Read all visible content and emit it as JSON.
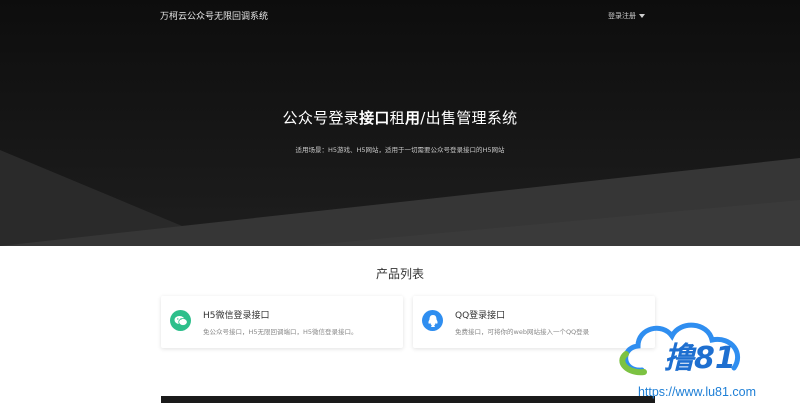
{
  "header": {
    "brand": "万柯云公众号无限回调系统",
    "login_register": "登录注册"
  },
  "hero": {
    "title_part1": "公众号登录",
    "title_bold1": "接口",
    "title_part2": "租",
    "title_bold2": "用",
    "title_part3": "/出售管理系统",
    "subtitle": "适用场景：H5游戏、H5网站，适用于一切需要公众号登录接口的H5网站"
  },
  "products": {
    "section_title": "产品列表",
    "items": [
      {
        "name": "H5微信登录接口",
        "desc": "免公众号接口，H5无限回调端口，H5微信登录接口。",
        "icon": "wechat-icon",
        "color": "#2dbf8b"
      },
      {
        "name": "QQ登录接口",
        "desc": "免费接口，可将你的web网站接入一个QQ登录",
        "icon": "qq-icon",
        "color": "#2f8ef0"
      }
    ]
  },
  "watermark": {
    "logo_text": "撸81",
    "url": "https://www.lu81.com"
  }
}
